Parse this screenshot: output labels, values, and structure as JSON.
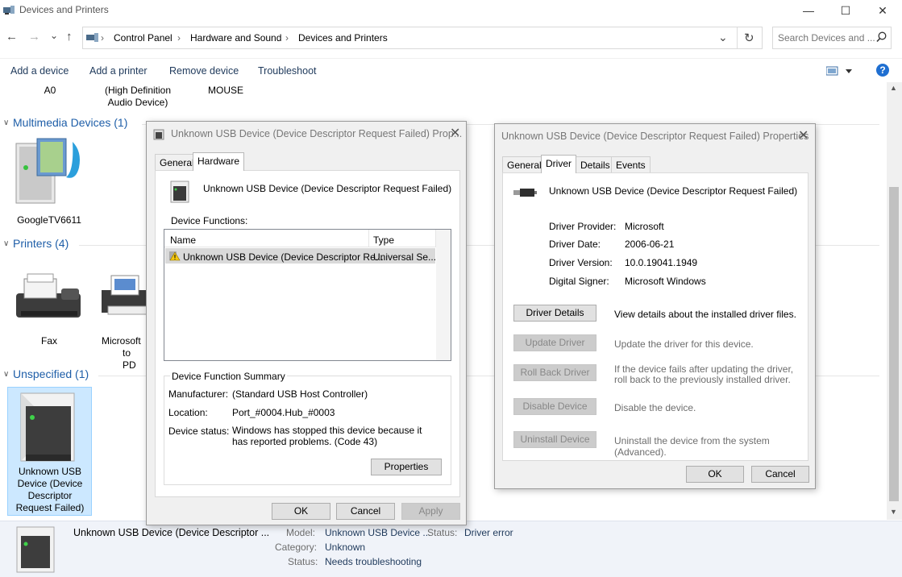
{
  "window": {
    "title": "Devices and Printers",
    "minimize": "—",
    "maximize": "☐",
    "close": "✕"
  },
  "address": {
    "back": "←",
    "forward": "→",
    "recent": "⌄",
    "up": "↑",
    "crumbs": [
      "Control Panel",
      "Hardware and Sound",
      "Devices and Printers"
    ],
    "sep": "›",
    "refresh": "↻",
    "search_placeholder": "Search Devices and ..."
  },
  "toolbar": {
    "add_device": "Add a device",
    "add_printer": "Add a printer",
    "remove_device": "Remove device",
    "troubleshoot": "Troubleshoot",
    "help": "?"
  },
  "top_partial": {
    "a0": "A0",
    "audio": "(High Definition\nAudio Device)",
    "mouse": "MOUSE"
  },
  "groups": {
    "multimedia": "Multimedia Devices (1)",
    "printers": "Printers (4)",
    "unspecified": "Unspecified (1)"
  },
  "devices": {
    "googletv": "GoogleTV6611",
    "fax": "Fax",
    "ms_pdf_1": "Microsoft",
    "ms_pdf_2": "to PD",
    "unknown": "Unknown USB Device (Device Descriptor Request Failed)"
  },
  "details_bar": {
    "name": "Unknown USB Device (Device Descriptor ...",
    "model_label": "Model:",
    "model_value": "Unknown USB Device ...",
    "status_label_right": "Status:",
    "status_value_right": "Driver error",
    "category_label": "Category:",
    "category_value": "Unknown",
    "status_label": "Status:",
    "status_value": "Needs troubleshooting"
  },
  "dialog1": {
    "title": "Unknown USB Device (Device Descriptor Request Failed) Prop...",
    "tabs": [
      "General",
      "Hardware"
    ],
    "device_name": "Unknown USB Device (Device Descriptor Request Failed)",
    "functions_label": "Device Functions:",
    "col_name": "Name",
    "col_type": "Type",
    "row_name": "Unknown USB Device (Device Descriptor Re...",
    "row_type": "Universal Se...",
    "summary_label": "Device Function Summary",
    "manufacturer_label": "Manufacturer:",
    "manufacturer_value": "(Standard USB Host Controller)",
    "location_label": "Location:",
    "location_value": "Port_#0004.Hub_#0003",
    "status_label": "Device status:",
    "status_value": "Windows has stopped this device because it has reported problems. (Code 43)",
    "properties": "Properties",
    "ok": "OK",
    "cancel": "Cancel",
    "apply": "Apply"
  },
  "dialog2": {
    "title": "Unknown USB Device (Device Descriptor Request Failed) Properties",
    "tabs": [
      "General",
      "Driver",
      "Details",
      "Events"
    ],
    "device_name": "Unknown USB Device (Device Descriptor Request Failed)",
    "provider_label": "Driver Provider:",
    "provider_value": "Microsoft",
    "date_label": "Driver Date:",
    "date_value": "2006-06-21",
    "version_label": "Driver Version:",
    "version_value": "10.0.19041.1949",
    "signer_label": "Digital Signer:",
    "signer_value": "Microsoft Windows",
    "driver_details": "Driver Details",
    "driver_details_desc": "View details about the installed driver files.",
    "update_driver": "Update Driver",
    "update_driver_desc": "Update the driver for this device.",
    "rollback": "Roll Back Driver",
    "rollback_desc": "If the device fails after updating the driver, roll back to the previously installed driver.",
    "disable": "Disable Device",
    "disable_desc": "Disable the device.",
    "uninstall": "Uninstall Device",
    "uninstall_desc": "Uninstall the device from the system (Advanced).",
    "ok": "OK",
    "cancel": "Cancel"
  },
  "colors": {
    "group_header": "#1e5ea8",
    "selection": "#cce8ff",
    "details_bg": "#f0f3f9"
  }
}
